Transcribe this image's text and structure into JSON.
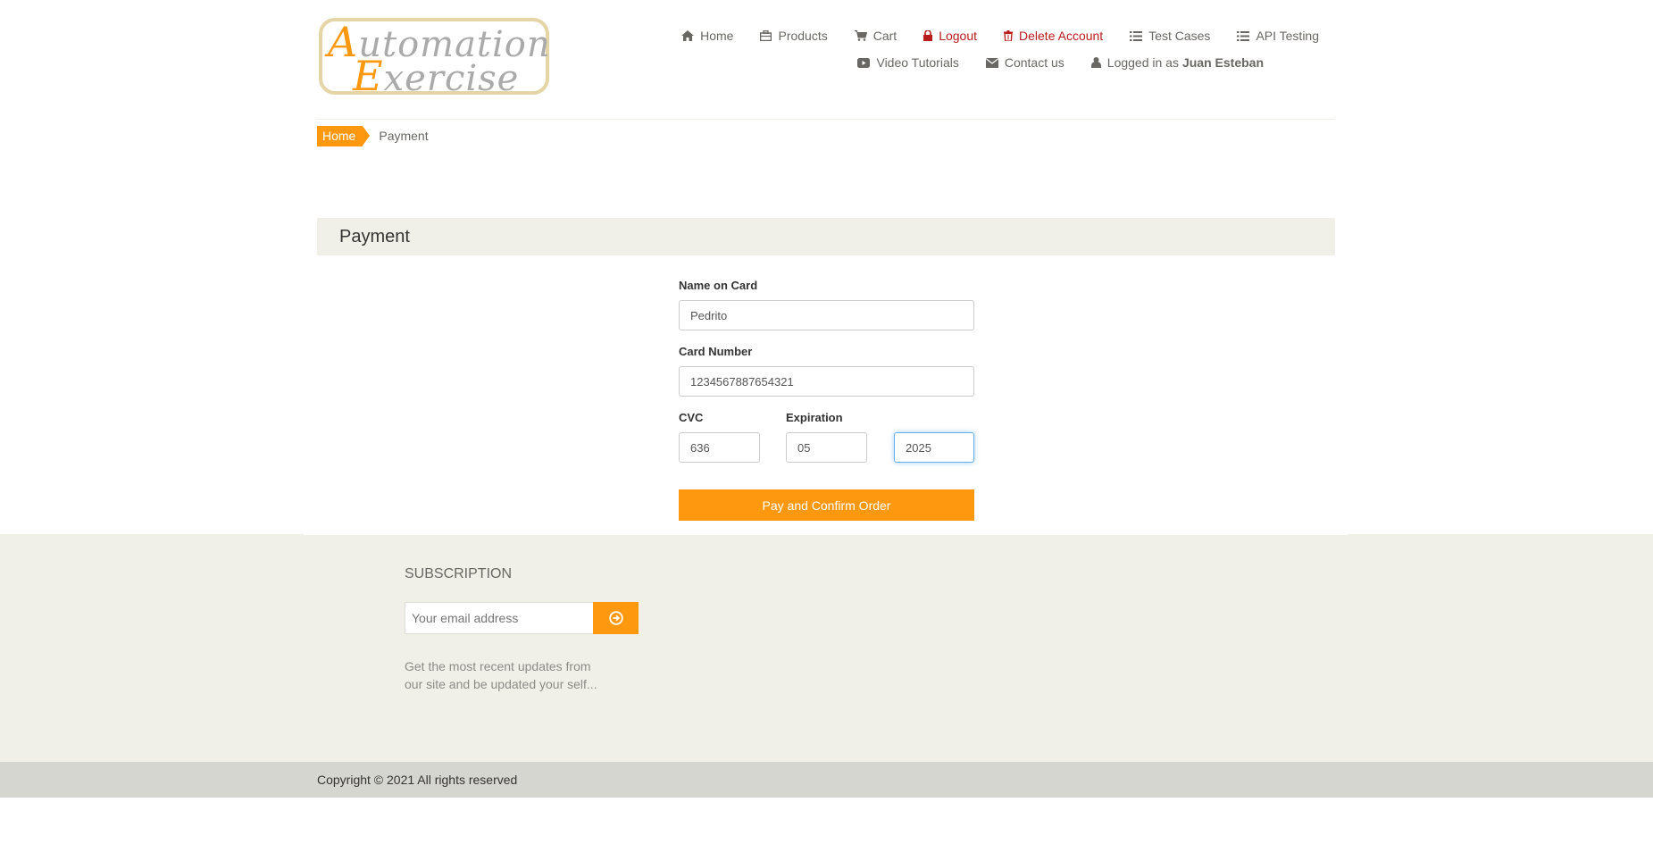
{
  "logo": {
    "line1_cap": "A",
    "line1_rest": "utomation",
    "line2_cap": "E",
    "line2_rest": "xercise"
  },
  "nav": {
    "home": "Home",
    "products": "Products",
    "cart": "Cart",
    "logout": "Logout",
    "delete_account": "Delete Account",
    "test_cases": "Test Cases",
    "api_testing": "API Testing",
    "video_tutorials": "Video Tutorials",
    "contact_us": "Contact us",
    "logged_in_prefix": "Logged in as",
    "logged_in_user": "Juan Esteban"
  },
  "breadcrumb": {
    "home": "Home",
    "current": "Payment"
  },
  "payment": {
    "heading": "Payment",
    "name_label": "Name on Card",
    "name_value": "Pedrito",
    "card_label": "Card Number",
    "card_value": "1234567887654321",
    "cvc_label": "CVC",
    "cvc_value": "636",
    "expiration_label": "Expiration",
    "exp_month_value": "05",
    "exp_year_value": "2025",
    "pay_button": "Pay and Confirm Order"
  },
  "subscription": {
    "title": "SUBSCRIPTION",
    "placeholder": "Your email address",
    "text": "Get the most recent updates from our site and be updated your self..."
  },
  "footer": {
    "copyright": "Copyright © 2021 All rights reserved"
  },
  "colors": {
    "accent": "#fe980f",
    "danger": "#b91c1c",
    "panel": "#f0f0e9",
    "footer_bar": "#d6d6d0"
  }
}
